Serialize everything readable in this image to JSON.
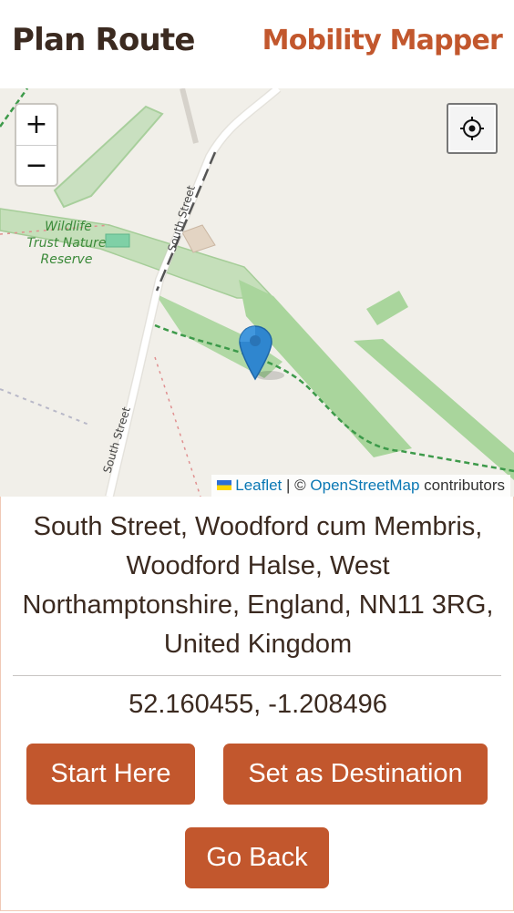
{
  "header": {
    "title": "Plan Route",
    "brand": "Mobility Mapper",
    "brand_color": "#c2572d"
  },
  "map": {
    "zoom_in_label": "+",
    "zoom_out_label": "−",
    "locate_icon": "crosshair-icon",
    "marker_icon": "map-pin-icon",
    "labels": {
      "reserve_line1": "Wildlife",
      "reserve_line2": "Trust Nature",
      "reserve_line3": "Reserve",
      "road_north": "South Street",
      "road_south": "South Street"
    },
    "attribution": {
      "leaflet": "Leaflet",
      "separator": "| ©",
      "osm": "OpenStreetMap",
      "suffix": "contributors"
    }
  },
  "location": {
    "address_lines": [
      "South Street, Woodford cum Membris,",
      "Woodford Halse, West",
      "Northamptonshire, England, NN11 3RG,",
      "United Kingdom"
    ],
    "coordinates": "52.160455, -1.208496"
  },
  "actions": {
    "start_label": "Start Here",
    "destination_label": "Set as Destination",
    "back_label": "Go Back"
  }
}
